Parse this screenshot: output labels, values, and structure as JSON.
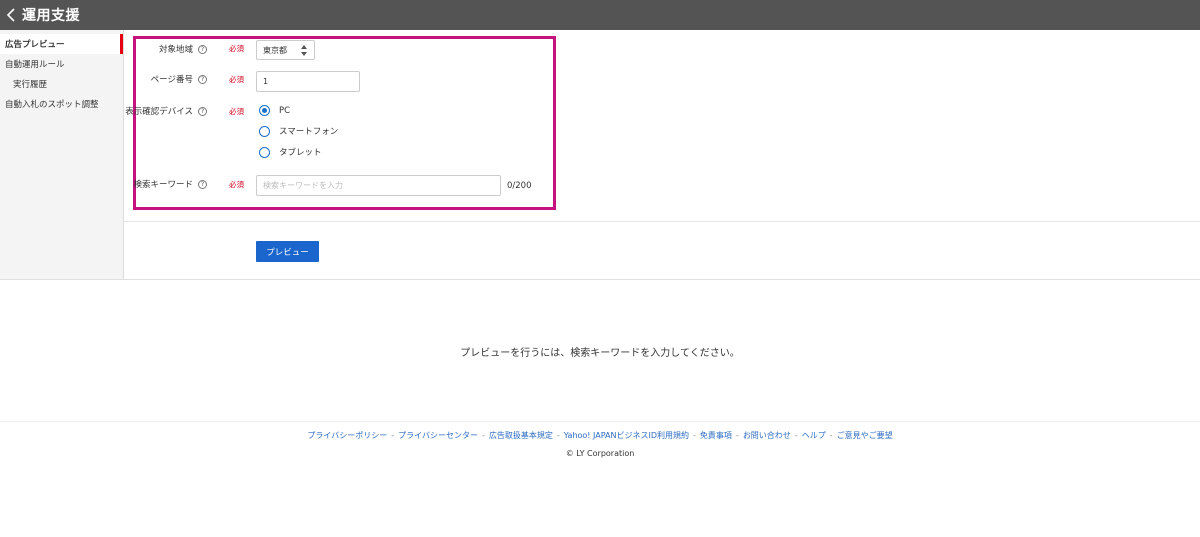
{
  "header": {
    "title": "運用支援"
  },
  "sidebar": {
    "items": [
      {
        "label": "広告プレビュー"
      },
      {
        "label": "自動運用ルール"
      },
      {
        "label": "実行履歴"
      },
      {
        "label": "自動入札のスポット調整"
      }
    ]
  },
  "form": {
    "help_glyph": "?",
    "required_label": "必須",
    "region": {
      "label": "対象地域",
      "value": "東京都"
    },
    "page_number": {
      "label": "ページ番号",
      "value": "1"
    },
    "device": {
      "label": "表示確認デバイス",
      "options": [
        "PC",
        "スマートフォン",
        "タブレット"
      ],
      "selected": "PC"
    },
    "keyword": {
      "label": "検索キーワード",
      "placeholder": "検索キーワードを入力",
      "value": "",
      "counter": "0/200"
    },
    "preview_button": "プレビュー"
  },
  "message": "プレビューを行うには、検索キーワードを入力してください。",
  "footer": {
    "separator": "-",
    "links": [
      "プライバシーポリシー",
      "プライバシーセンター",
      "広告取扱基本規定",
      "Yahoo! JAPANビジネスID利用規約",
      "免責事項",
      "お問い合わせ",
      "ヘルプ",
      "ご意見やご要望"
    ],
    "copyright": "© LY Corporation"
  },
  "colors": {
    "header_bg": "#545454",
    "accent_blue": "#1a66cc",
    "required_red": "#d0021b",
    "highlight_magenta": "#c5137d",
    "active_marker": "#e60012"
  }
}
